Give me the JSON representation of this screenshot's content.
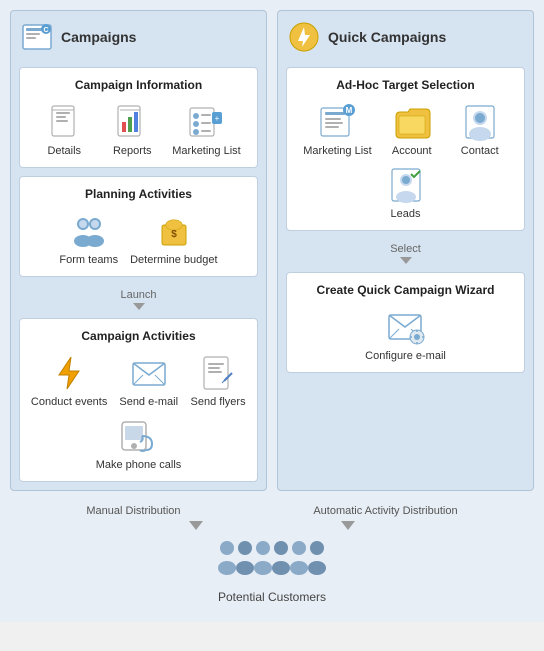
{
  "campaigns": {
    "title": "Campaigns",
    "campaign_info": {
      "title": "Campaign Information",
      "items": [
        {
          "label": "Details",
          "icon": "document-icon"
        },
        {
          "label": "Reports",
          "icon": "chart-icon"
        },
        {
          "label": "Marketing List",
          "icon": "list-icon"
        }
      ]
    },
    "planning": {
      "title": "Planning Activities",
      "items": [
        {
          "label": "Form teams",
          "icon": "teams-icon"
        },
        {
          "label": "Determine budget",
          "icon": "budget-icon"
        }
      ],
      "arrow_label": "Launch"
    },
    "activities": {
      "title": "Campaign Activities",
      "items": [
        {
          "label": "Conduct events",
          "icon": "lightning-icon"
        },
        {
          "label": "Send e-mail",
          "icon": "email-icon"
        },
        {
          "label": "Send flyers",
          "icon": "flyer-icon"
        },
        {
          "label": "Make phone calls",
          "icon": "phone-icon"
        }
      ]
    }
  },
  "quick_campaigns": {
    "title": "Quick Campaigns",
    "adhoc": {
      "title": "Ad-Hoc Target Selection",
      "items": [
        {
          "label": "Marketing List",
          "icon": "mktlist-icon"
        },
        {
          "label": "Account",
          "icon": "account-icon"
        },
        {
          "label": "Contact",
          "icon": "contact-icon"
        },
        {
          "label": "Leads",
          "icon": "leads-icon"
        }
      ],
      "arrow_label": "Select"
    },
    "wizard": {
      "title": "Create Quick Campaign Wizard",
      "items": [
        {
          "label": "Configure e-mail",
          "icon": "configure-email-icon"
        }
      ]
    }
  },
  "bottom": {
    "left_label": "Manual Distribution",
    "right_label": "Automatic Activity Distribution",
    "customers_label": "Potential Customers"
  }
}
